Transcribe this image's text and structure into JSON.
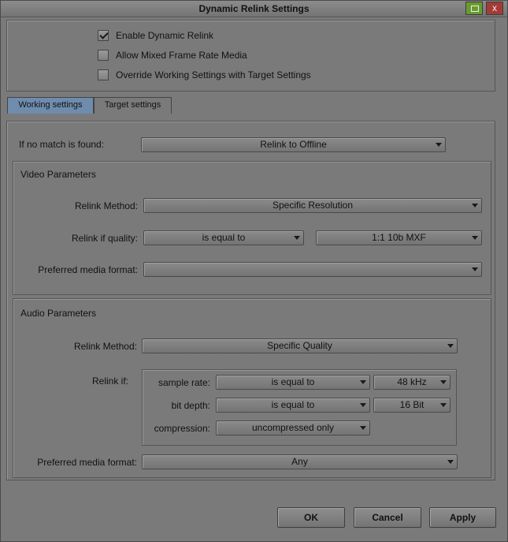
{
  "window": {
    "title": "Dynamic Relink Settings",
    "close_glyph": "x"
  },
  "options": {
    "enable_dynamic_relink": {
      "label": "Enable Dynamic Relink",
      "checked": true
    },
    "allow_mixed_frame_rate": {
      "label": "Allow Mixed Frame Rate Media",
      "checked": false
    },
    "override_working_settings": {
      "label": "Override Working Settings with Target Settings",
      "checked": false
    }
  },
  "tabs": [
    {
      "label": "Working settings",
      "active": true
    },
    {
      "label": "Target settings",
      "active": false
    }
  ],
  "no_match": {
    "label": "If no match is found:",
    "value": "Relink to Offline"
  },
  "video": {
    "heading": "Video Parameters",
    "relink_method_label": "Relink Method:",
    "relink_method_value": "Specific Resolution",
    "relink_quality_label": "Relink if quality:",
    "relink_quality_condition": "is equal to",
    "relink_quality_value": "1:1 10b  MXF",
    "preferred_format_label": "Preferred media format:",
    "preferred_format_value": ""
  },
  "audio": {
    "heading": "Audio Parameters",
    "relink_method_label": "Relink Method:",
    "relink_method_value": "Specific Quality",
    "relink_if_label": "Relink if:",
    "sample_rate_label": "sample rate:",
    "sample_rate_condition": "is equal to",
    "sample_rate_value": "48 kHz",
    "bit_depth_label": "bit depth:",
    "bit_depth_condition": "is equal to",
    "bit_depth_value": "16 Bit",
    "compression_label": "compression:",
    "compression_value": "uncompressed only",
    "preferred_format_label": "Preferred media format:",
    "preferred_format_value": "Any"
  },
  "buttons": {
    "ok": "OK",
    "cancel": "Cancel",
    "apply": "Apply"
  }
}
